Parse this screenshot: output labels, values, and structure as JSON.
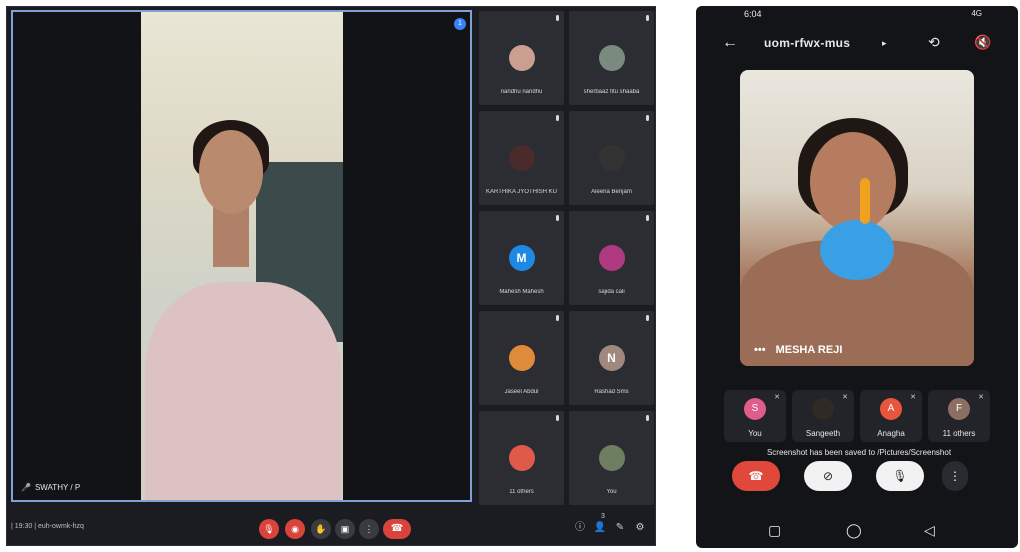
{
  "desktop": {
    "pinned_badge": "1",
    "speaker_name": "SWATHY / P",
    "tiles": [
      {
        "name": "nandhu nandhu",
        "avatar_color": "#c9a08f",
        "initial": ""
      },
      {
        "name": "sherbaaz fitu shaaba",
        "avatar_color": "#7a8a7f",
        "initial": ""
      },
      {
        "name": "KARTHIKA JYOTHISH KU",
        "avatar_color": "#4a2a2a",
        "initial": ""
      },
      {
        "name": "Aleena Benjam",
        "avatar_color": "#333333",
        "initial": ""
      },
      {
        "name": "Mahesh Mahesh",
        "avatar_color": "#1e88e5",
        "initial": "M"
      },
      {
        "name": "sajida cali",
        "avatar_color": "#b03a80",
        "initial": ""
      },
      {
        "name": "Jaseel Abdul",
        "avatar_color": "#e08a3c",
        "initial": ""
      },
      {
        "name": "Rashad Sms",
        "avatar_color": "#a1887f",
        "initial": "N"
      },
      {
        "name": "11 others",
        "avatar_color": "#e05a4a",
        "initial": ""
      },
      {
        "name": "You",
        "avatar_color": "#6d7f60",
        "initial": ""
      }
    ],
    "bottom": {
      "time_and_code": "| 19:30  |  euh-owmk-hzq",
      "info_count": "3"
    }
  },
  "phone": {
    "status_time": "6:04",
    "status_right": "4G",
    "room_code": "uom-rfwx-mus",
    "main_speaker": "MESHA REJI",
    "more_label": "•••",
    "participants": [
      {
        "name": "You",
        "initial": "S",
        "color": "#e05c8a"
      },
      {
        "name": "Sangeeth",
        "initial": "",
        "color": "#2f2a25"
      },
      {
        "name": "Anagha",
        "initial": "A",
        "color": "#e8553f"
      },
      {
        "name": "11 others",
        "initial": "F",
        "color": "#8d6e63"
      }
    ],
    "toast": "Screenshot has been saved to /Pictures/Screenshot",
    "colors": {
      "end_call": "#e0483c",
      "bg": "#131418"
    }
  }
}
